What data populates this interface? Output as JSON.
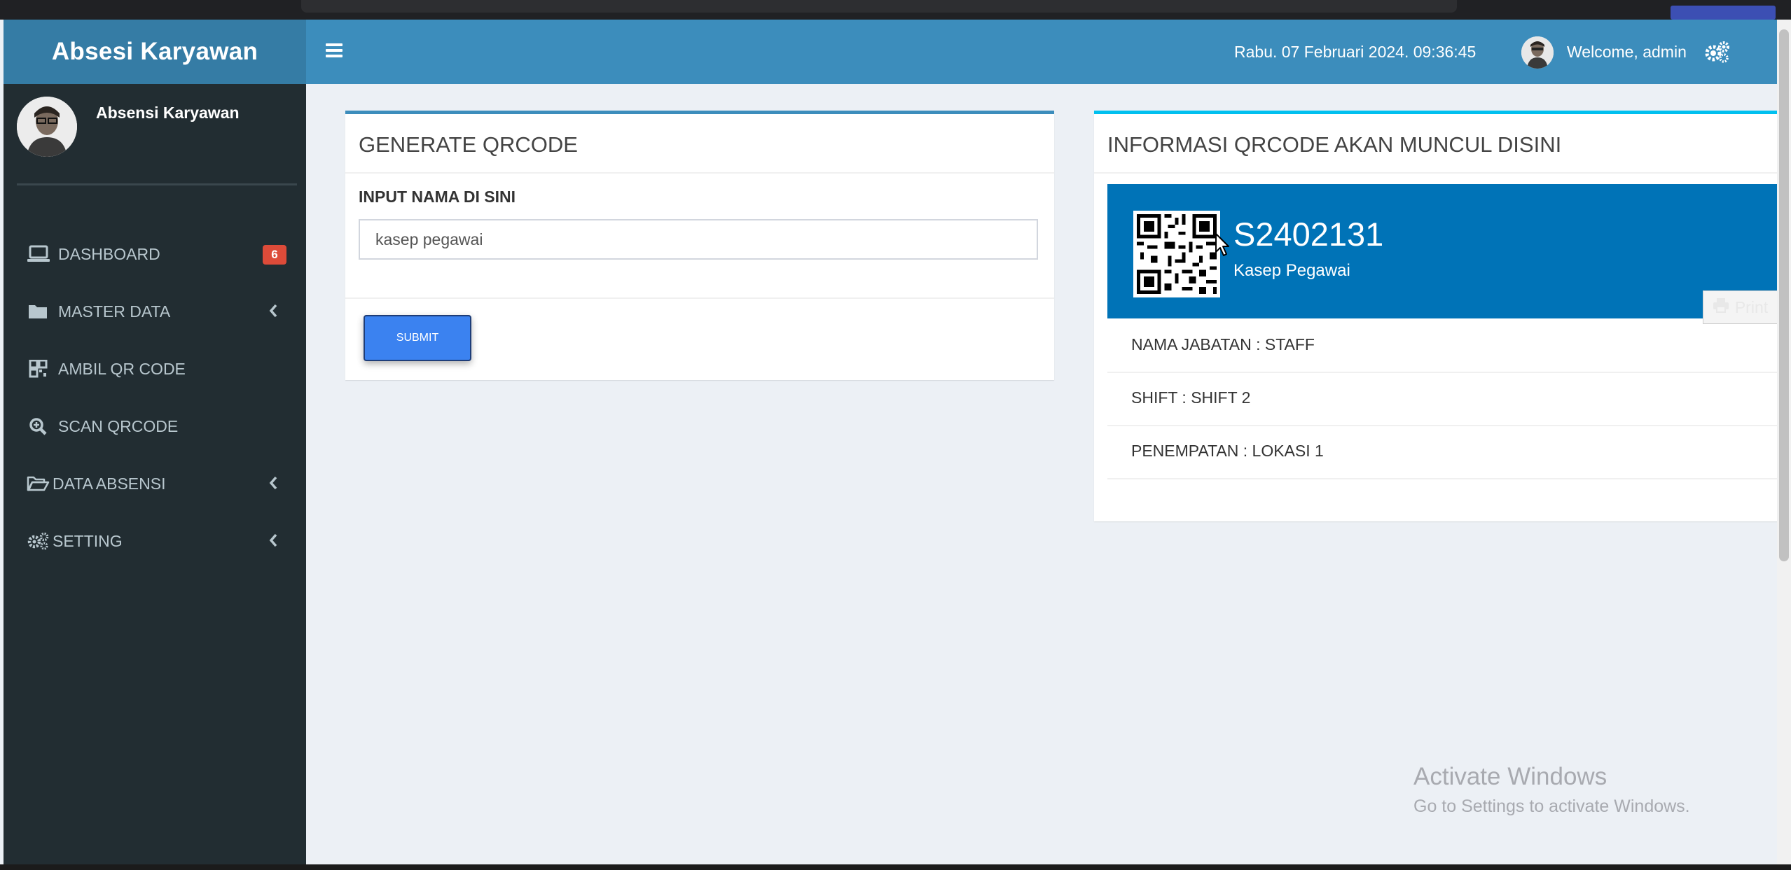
{
  "header": {
    "logo": "Absesi Karyawan",
    "datetime": "Rabu. 07 Februari 2024. 09:36:45",
    "welcome": "Welcome, admin"
  },
  "sidebar": {
    "user_name": "Absensi Karyawan",
    "items": [
      {
        "label": "DASHBOARD",
        "icon": "laptop-icon",
        "badge": "6"
      },
      {
        "label": "MASTER DATA",
        "icon": "folder-icon",
        "has_submenu": true
      },
      {
        "label": "AMBIL QR CODE",
        "icon": "qrcode-icon"
      },
      {
        "label": "SCAN QRCODE",
        "icon": "search-plus-icon"
      },
      {
        "label": "DATA ABSENSI",
        "icon": "folder-open-icon",
        "has_submenu": true
      },
      {
        "label": "SETTING",
        "icon": "gears-icon",
        "has_submenu": true
      }
    ]
  },
  "generate": {
    "title": "GENERATE QRCODE",
    "field_label": "INPUT NAMA DI SINI",
    "input_value": "kasep pegawai",
    "submit_label": "SUBMIT"
  },
  "info": {
    "title": "INFORMASI QRCODE AKAN MUNCUL DISINI",
    "code": "S2402131",
    "name": "Kasep Pegawai",
    "print_label": "Print",
    "rows": [
      "NAMA JABATAN : STAFF",
      "SHIFT : SHIFT 2",
      "PENEMPATAN : LOKASI 1"
    ]
  },
  "watermark": {
    "line1": "Activate Windows",
    "line2": "Go to Settings to activate Windows."
  },
  "colors": {
    "header": "#3c8dbc",
    "logo_bg": "#357ca5",
    "sidebar": "#222d32",
    "qr_card": "#0073b7",
    "badge": "#dd4b39",
    "submit": "#3b82f0"
  }
}
